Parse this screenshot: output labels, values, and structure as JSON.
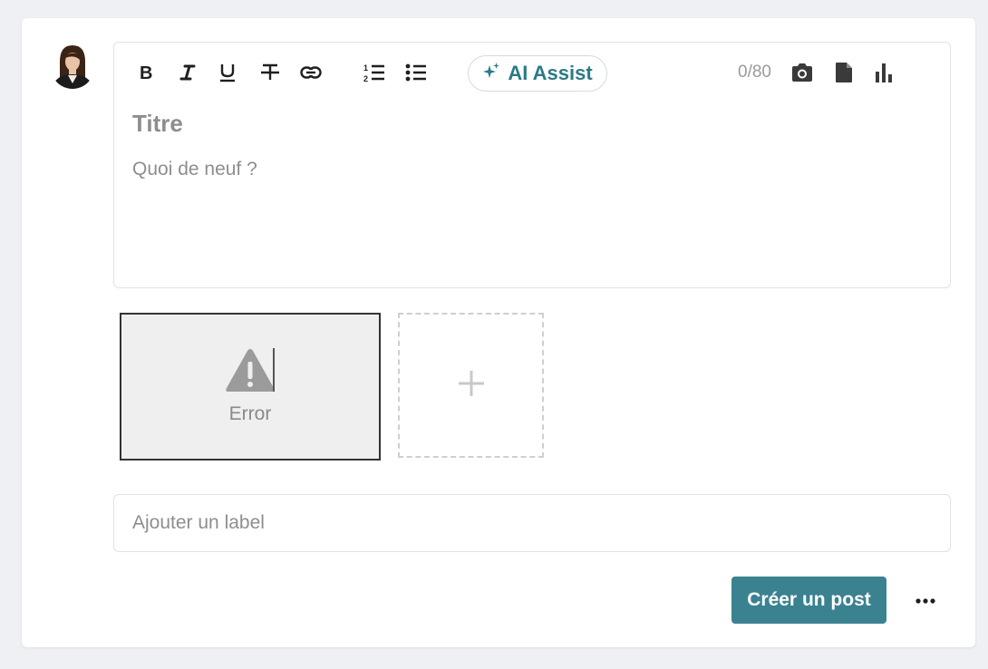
{
  "composer": {
    "avatar_alt": "user avatar",
    "toolbar": {
      "bold_icon": "bold-icon",
      "italic_icon": "italic-icon",
      "underline_icon": "underline-icon",
      "strikethrough_icon": "strikethrough-icon",
      "link_icon": "link-icon",
      "ordered_list_icon": "ordered-list-icon",
      "bullet_list_icon": "bullet-list-icon",
      "ai_assist_label": "AI Assist",
      "char_counter": "0/80",
      "camera_icon": "camera-icon",
      "document_icon": "document-icon",
      "poll_icon": "bar-chart-icon"
    },
    "title_placeholder": "Titre",
    "body_placeholder": "Quoi de neuf ?",
    "media": {
      "error_label": "Error",
      "add_symbol": "+"
    },
    "label_placeholder": "Ajouter un label",
    "create_button_label": "Créer un post",
    "more_label": "•••"
  },
  "colors": {
    "accent": "#3b8290",
    "ai_text": "#2c7a86",
    "placeholder": "#8e8e8e",
    "background": "#eef0f4"
  }
}
